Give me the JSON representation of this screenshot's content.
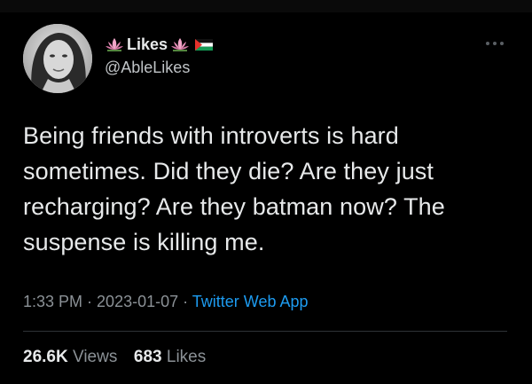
{
  "user": {
    "display_name": "Likes",
    "handle": "@AbleLikes"
  },
  "icons": {
    "left_emoji": "lotus-icon",
    "right_emoji": "lotus-icon",
    "flag": "palestine-flag-icon",
    "more": "more-options-icon"
  },
  "tweet": {
    "text_lines": [
      "Being friends with introverts is hard",
      "sometimes. Did they die? Are they just",
      "recharging? Are they batman now? The",
      "suspense is killing me."
    ],
    "time": "1:33 PM",
    "date": "2023-01-07",
    "separator": " · ",
    "source": "Twitter Web App"
  },
  "stats": {
    "views_count": "26.6K",
    "views_label": "Views",
    "likes_count": "683",
    "likes_label": "Likes"
  },
  "colors": {
    "background": "#000000",
    "text": "#e7e9ea",
    "secondary": "#8b9196",
    "link": "#1d9bf0"
  }
}
